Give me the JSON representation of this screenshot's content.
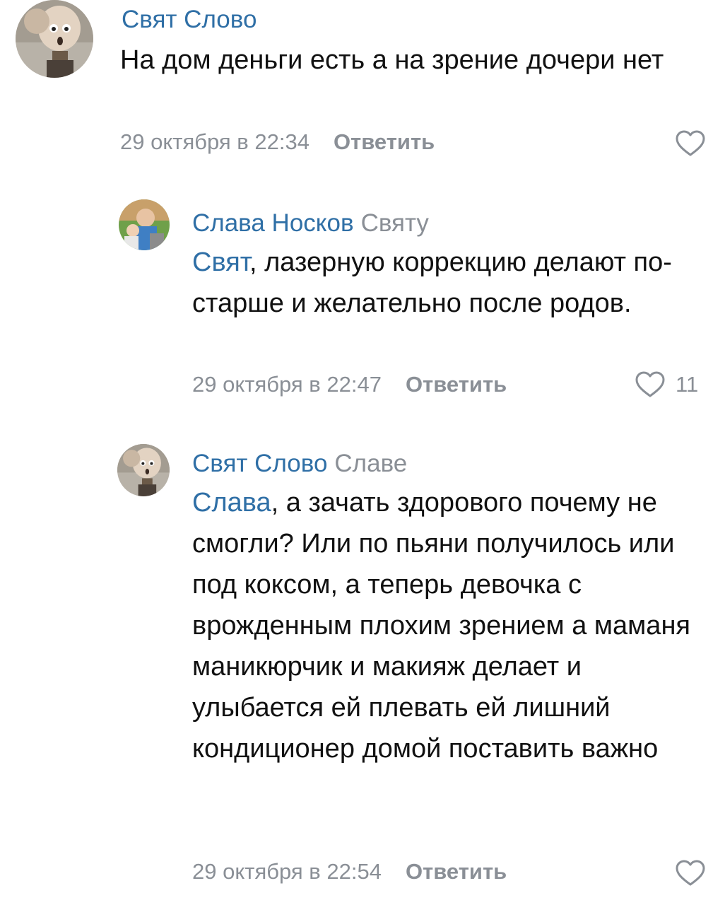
{
  "comments": [
    {
      "author": "Свят Слово",
      "reply_to": "",
      "mention": "",
      "text": "На дом деньги есть а на зрение дочери нет",
      "time": "29 октября в 22:34",
      "reply_label": "Ответить",
      "likes": ""
    },
    {
      "author": "Слава Носков",
      "reply_to": "Святу",
      "mention": "Свят",
      "text": ", лазерную коррекцию делают по-старше и желательно после родов.",
      "time": "29 октября в 22:47",
      "reply_label": "Ответить",
      "likes": "11"
    },
    {
      "author": "Свят Слово",
      "reply_to": "Славе",
      "mention": "Слава",
      "text": ", а зачать здорового почему не смогли? Или по пьяни получилось или под коксом, а теперь девочка с врожденным плохим зрением а маманя маникюрчик и макияж делает и улыбается ей плевать ей лишний кондиционер домой поставить важно",
      "time": "29 октября в 22:54",
      "reply_label": "Ответить",
      "likes": ""
    }
  ],
  "colors": {
    "link": "#2f6fa6",
    "meta": "#8a8f96",
    "text": "#111111"
  },
  "icons": [
    "avatar-cartoon-icon",
    "avatar-photo-icon",
    "heart-outline-icon"
  ]
}
